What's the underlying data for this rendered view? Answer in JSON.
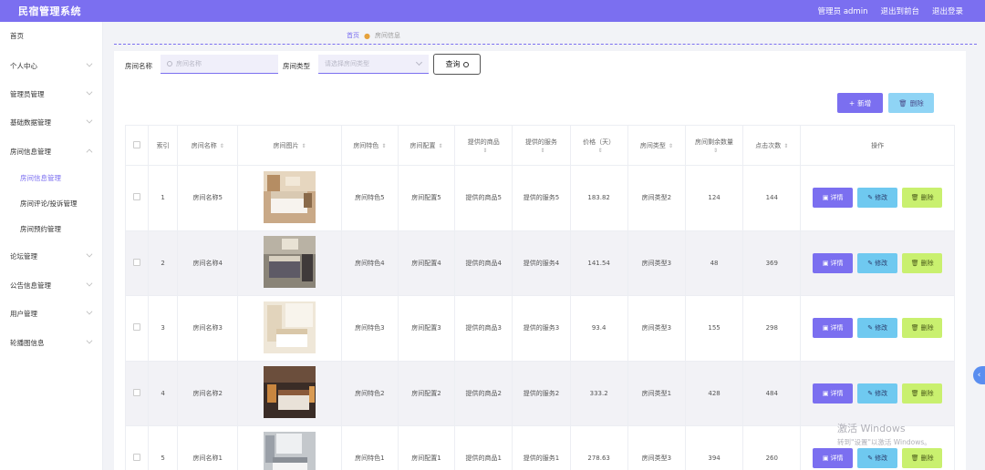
{
  "app": {
    "title": "民宿管理系统"
  },
  "header": {
    "user": "管理员 admin",
    "to_front": "退出到前台",
    "logout": "退出登录"
  },
  "sidebar": {
    "items": [
      {
        "label": "首页"
      },
      {
        "label": "个人中心"
      },
      {
        "label": "管理员管理"
      },
      {
        "label": "基础数据管理"
      },
      {
        "label": "房间信息管理"
      },
      {
        "label": "房间信息管理"
      },
      {
        "label": "房间评论/投诉管理"
      },
      {
        "label": "房间预约管理"
      },
      {
        "label": "论坛管理"
      },
      {
        "label": "公告信息管理"
      },
      {
        "label": "用户管理"
      },
      {
        "label": "轮播图信息"
      }
    ]
  },
  "breadcrumb": {
    "home": "首页",
    "current": "房间信息"
  },
  "search": {
    "name_label": "房间名称",
    "name_placeholder": "房间名称",
    "type_label": "房间类型",
    "type_placeholder": "请选择房间类型",
    "query_label": "查询"
  },
  "actions": {
    "add_label": "新增",
    "delete_label": "删除"
  },
  "table": {
    "headers": [
      "索引",
      "房间名称",
      "房间图片",
      "房间特色",
      "房间配置",
      "提供的商品",
      "提供的服务",
      "价格（天）",
      "房间类型",
      "房间剩余数量",
      "点击次数",
      "操作"
    ],
    "rows": [
      {
        "index": "1",
        "name": "房间名称5",
        "feature": "房间特色5",
        "config": "房间配置5",
        "goods": "提供的商品5",
        "service": "提供的服务5",
        "price": "183.82",
        "type": "房间类型2",
        "remaining": "124",
        "clicks": "144"
      },
      {
        "index": "2",
        "name": "房间名称4",
        "feature": "房间特色4",
        "config": "房间配置4",
        "goods": "提供的商品4",
        "service": "提供的服务4",
        "price": "141.54",
        "type": "房间类型3",
        "remaining": "48",
        "clicks": "369"
      },
      {
        "index": "3",
        "name": "房间名称3",
        "feature": "房间特色3",
        "config": "房间配置3",
        "goods": "提供的商品3",
        "service": "提供的服务3",
        "price": "93.4",
        "type": "房间类型3",
        "remaining": "155",
        "clicks": "298"
      },
      {
        "index": "4",
        "name": "房间名称2",
        "feature": "房间特色2",
        "config": "房间配置2",
        "goods": "提供的商品2",
        "service": "提供的服务2",
        "price": "333.2",
        "type": "房间类型1",
        "remaining": "428",
        "clicks": "484"
      },
      {
        "index": "5",
        "name": "房间名称1",
        "feature": "房间特色1",
        "config": "房间配置1",
        "goods": "提供的商品1",
        "service": "提供的服务1",
        "price": "278.63",
        "type": "房间类型3",
        "remaining": "394",
        "clicks": "260"
      }
    ],
    "op_labels": {
      "detail": "详情",
      "edit": "修改",
      "remove": "删除"
    }
  },
  "watermark": {
    "line1": "激活 Windows",
    "line2": "转到\"设置\"以激活 Windows。"
  },
  "colors": {
    "primary": "#7b6ff0",
    "info": "#6fc9f0",
    "lime": "#c9f06f"
  }
}
